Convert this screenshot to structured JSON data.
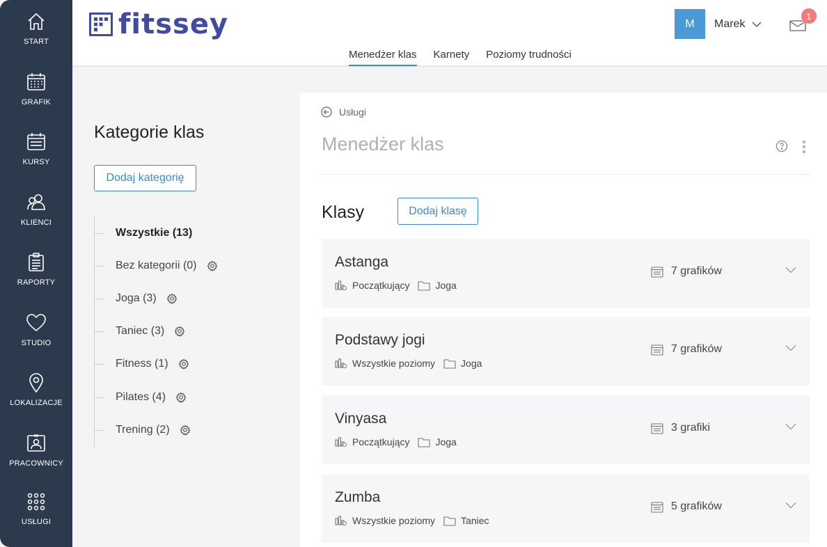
{
  "sidebar": {
    "items": [
      {
        "label": "START",
        "icon": "home-icon"
      },
      {
        "label": "GRAFIK",
        "icon": "calendar-icon"
      },
      {
        "label": "KURSY",
        "icon": "courses-icon"
      },
      {
        "label": "KLIENCI",
        "icon": "users-icon"
      },
      {
        "label": "RAPORTY",
        "icon": "clipboard-icon"
      },
      {
        "label": "STUDIO",
        "icon": "heart-icon"
      },
      {
        "label": "LOKALIZACJE",
        "icon": "location-pin-icon"
      },
      {
        "label": "PRACOWNICY",
        "icon": "id-badge-icon"
      },
      {
        "label": "USŁUGI",
        "icon": "grid-dots-icon"
      }
    ]
  },
  "header": {
    "logo_text": "fitssey",
    "tabs": [
      {
        "label": "Menedżer klas",
        "active": true
      },
      {
        "label": "Karnety",
        "active": false
      },
      {
        "label": "Poziomy trudności",
        "active": false
      }
    ],
    "user": {
      "initial": "M",
      "name": "Marek"
    },
    "notifications_count": "1"
  },
  "categories_panel": {
    "title": "Kategorie klas",
    "add_button": "Dodaj kategorię",
    "items": [
      {
        "label": "Wszystkie (13)",
        "bold": true,
        "gear": false
      },
      {
        "label": "Bez kategorii (0)",
        "bold": false,
        "gear": true
      },
      {
        "label": "Joga (3)",
        "bold": false,
        "gear": true
      },
      {
        "label": "Taniec (3)",
        "bold": false,
        "gear": true
      },
      {
        "label": "Fitness (1)",
        "bold": false,
        "gear": true
      },
      {
        "label": "Pilates (4)",
        "bold": false,
        "gear": true
      },
      {
        "label": "Trening (2)",
        "bold": false,
        "gear": true
      }
    ]
  },
  "main": {
    "back_label": "Usługi",
    "title": "Menedżer klas",
    "section_title": "Klasy",
    "add_button": "Dodaj klasę",
    "classes": [
      {
        "name": "Astanga",
        "level": "Początkujący",
        "category": "Joga",
        "schedules": "7 grafików"
      },
      {
        "name": "Podstawy jogi",
        "level": "Wszystkie poziomy",
        "category": "Joga",
        "schedules": "7 grafików"
      },
      {
        "name": "Vinyasa",
        "level": "Początkujący",
        "category": "Joga",
        "schedules": "3 grafiki"
      },
      {
        "name": "Zumba",
        "level": "Wszystkie poziomy",
        "category": "Taniec",
        "schedules": "5 grafików"
      }
    ]
  },
  "colors": {
    "sidebar_bg": "#2c3a4e",
    "accent": "#3a8ad1",
    "logo": "#3f4aa0",
    "badge": "#f27b7b",
    "avatar": "#4a9ad8"
  }
}
